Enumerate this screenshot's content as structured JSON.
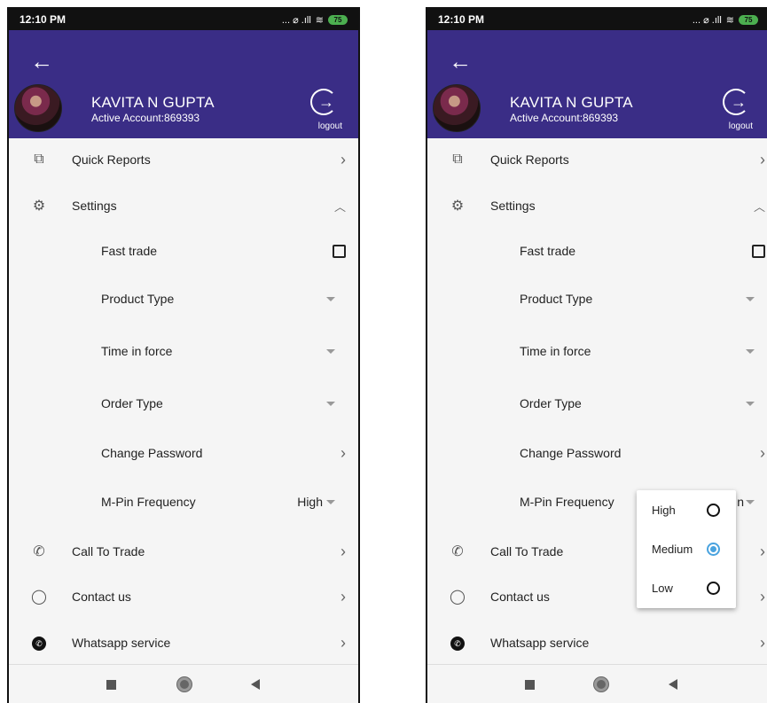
{
  "status_bar": {
    "time": "12:10 PM",
    "icons_text": "... ⌀ .ıll",
    "battery": "75"
  },
  "header": {
    "back_icon": "back-arrow-icon",
    "user_name": "KAVITA N GUPTA",
    "account": "Active Account:869393",
    "logout_label": "logout"
  },
  "menu": {
    "quick_reports": "Quick Reports",
    "settings": "Settings",
    "fast_trade": "Fast trade",
    "product_type": "Product Type",
    "time_in_force": "Time in force",
    "order_type": "Order Type",
    "change_password": "Change Password",
    "mpin_frequency": "M-Pin Frequency",
    "mpin_value": "High",
    "mpin_value_partial": "n",
    "call_to_trade": "Call To Trade",
    "contact_us": "Contact us",
    "whatsapp": "Whatsapp service"
  },
  "popup": {
    "options": [
      "High",
      "Medium",
      "Low"
    ],
    "selected": "Medium"
  },
  "colors": {
    "header_bg": "#3a2d86",
    "radio_selected": "#4aa3df"
  }
}
